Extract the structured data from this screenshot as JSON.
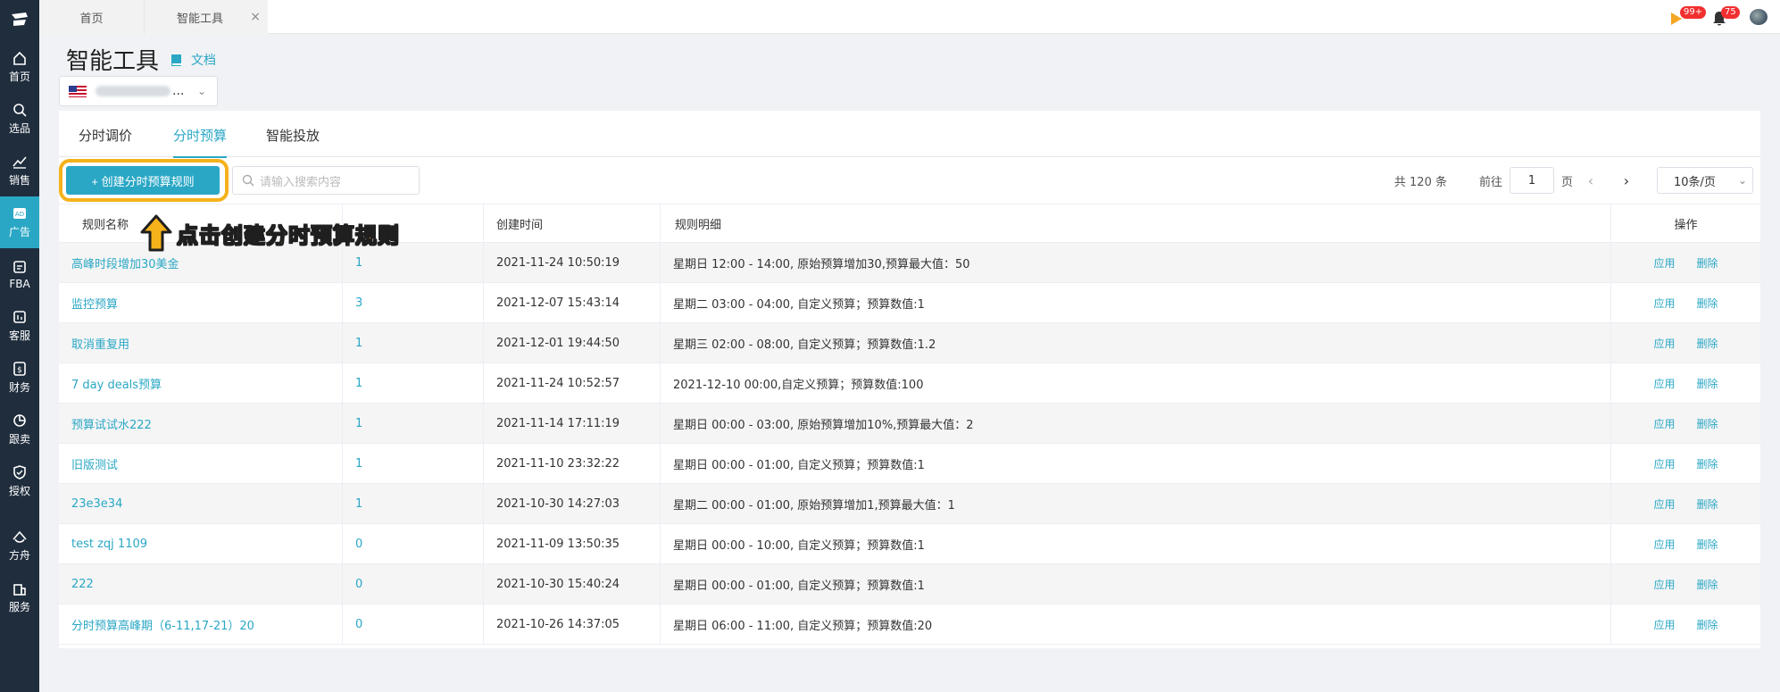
{
  "sidebar": {
    "items": [
      {
        "label": "首页",
        "icon": "home-icon"
      },
      {
        "label": "选品",
        "icon": "search-icon"
      },
      {
        "label": "销售",
        "icon": "chart-icon"
      },
      {
        "label": "广告",
        "icon": "ad-icon",
        "active": true
      },
      {
        "label": "FBA",
        "icon": "fba-icon"
      },
      {
        "label": "客服",
        "icon": "service-icon"
      },
      {
        "label": "财务",
        "icon": "finance-icon"
      },
      {
        "label": "跟卖",
        "icon": "pie-icon"
      },
      {
        "label": "授权",
        "icon": "shield-icon"
      },
      {
        "label": "方舟",
        "icon": "ark-icon"
      },
      {
        "label": "服务",
        "icon": "building-icon"
      }
    ]
  },
  "topbar": {
    "tabs": [
      {
        "label": "首页"
      },
      {
        "label": "智能工具",
        "close": "×"
      }
    ],
    "notifications": {
      "play_badge": "99+",
      "bell_badge": "75"
    }
  },
  "header": {
    "title": "智能工具",
    "doc_link": "文档"
  },
  "shop_select": {
    "ellipsis": "..."
  },
  "subtabs": [
    "分时调价",
    "分时预算",
    "智能投放"
  ],
  "toolbar": {
    "create_button": "+ 创建分时预算规则",
    "search_placeholder": "请输入搜索内容",
    "total": "共 120 条",
    "goto": "前往",
    "page": "1",
    "page_suffix": "页",
    "page_size": "10条/页"
  },
  "table": {
    "headers": [
      "规则名称",
      "",
      "创建时间",
      "规则明细",
      "操作"
    ],
    "rows": [
      {
        "name": "高峰时段增加30美金",
        "count": "1",
        "created": "2021-11-24 10:50:19",
        "detail": "星期日 12:00 - 14:00, 原始预算增加30,预算最大值：50"
      },
      {
        "name": "监控预算",
        "count": "3",
        "created": "2021-12-07 15:43:14",
        "detail": "星期二 03:00 - 04:00, 自定义预算；预算数值:1"
      },
      {
        "name": "取消重复用",
        "count": "1",
        "created": "2021-12-01 19:44:50",
        "detail": "星期三 02:00 - 08:00, 自定义预算；预算数值:1.2"
      },
      {
        "name": "7 day deals预算",
        "count": "1",
        "created": "2021-11-24 10:52:57",
        "detail": "2021-12-10 00:00,自定义预算；预算数值:100"
      },
      {
        "name": "预算试试水222",
        "count": "1",
        "created": "2021-11-14 17:11:19",
        "detail": "星期日 00:00 - 03:00, 原始预算增加10%,预算最大值：2"
      },
      {
        "name": "旧版测试",
        "count": "1",
        "created": "2021-11-10 23:32:22",
        "detail": "星期日 00:00 - 01:00, 自定义预算；预算数值:1"
      },
      {
        "name": "23e3e34",
        "count": "1",
        "created": "2021-10-30 14:27:03",
        "detail": "星期二 00:00 - 01:00, 原始预算增加1,预算最大值：1"
      },
      {
        "name": "test zqj 1109",
        "count": "0",
        "created": "2021-11-09 13:50:35",
        "detail": "星期日 00:00 - 10:00, 自定义预算；预算数值:1"
      },
      {
        "name": "222",
        "count": "0",
        "created": "2021-10-30 15:40:24",
        "detail": "星期日 00:00 - 01:00, 自定义预算；预算数值:1"
      },
      {
        "name": "分时预算高峰期（6-11,17-21）20",
        "count": "0",
        "created": "2021-10-26 14:37:05",
        "detail": "星期日 06:00 - 11:00, 自定义预算；预算数值:20"
      }
    ],
    "op_apply": "应用",
    "op_delete": "删除"
  },
  "annotation": {
    "text": "点击创建分时预算规则"
  },
  "colors": {
    "accent": "#2aa7c5",
    "sidebar": "#1f2d3d",
    "highlight": "#f5b21a",
    "badge": "#f23030"
  }
}
